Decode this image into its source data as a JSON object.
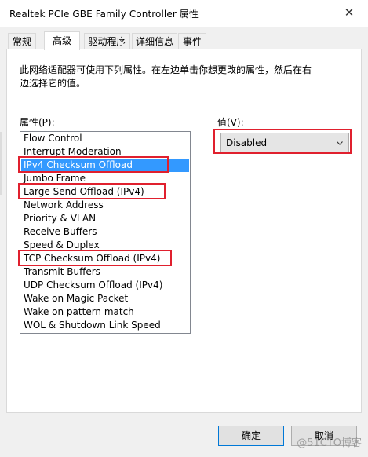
{
  "window": {
    "title": "Realtek PCIe GBE Family Controller 属性",
    "close_glyph": "✕"
  },
  "tabs": [
    {
      "label": "常规",
      "active": false
    },
    {
      "label": "高级",
      "active": true
    },
    {
      "label": "驱动程序",
      "active": false
    },
    {
      "label": "详细信息",
      "active": false
    },
    {
      "label": "事件",
      "active": false
    }
  ],
  "panel": {
    "description": "此网络适配器可使用下列属性。在左边单击你想更改的属性，然后在右边选择它的值。",
    "property_label": "属性(P):",
    "value_label": "值(V):",
    "properties": [
      "Flow Control",
      "Interrupt Moderation",
      "IPv4 Checksum Offload",
      "Jumbo Frame",
      "Large Send Offload (IPv4)",
      "Network Address",
      "Priority & VLAN",
      "Receive Buffers",
      "Speed & Duplex",
      "TCP Checksum Offload (IPv4)",
      "Transmit Buffers",
      "UDP Checksum Offload (IPv4)",
      "Wake on Magic Packet",
      "Wake on pattern match",
      "WOL & Shutdown Link Speed"
    ],
    "selected_index": 2,
    "highlighted_indices": [
      2,
      4,
      9
    ],
    "value": "Disabled"
  },
  "buttons": {
    "ok": "确定",
    "cancel": "取消"
  },
  "watermark": "@51CTO博客",
  "colors": {
    "selection": "#3399ff",
    "annotation": "#e0202e",
    "default_button_border": "#0078d7"
  },
  "icons": {
    "close": "close-icon",
    "dropdown": "chevron-down-icon"
  }
}
